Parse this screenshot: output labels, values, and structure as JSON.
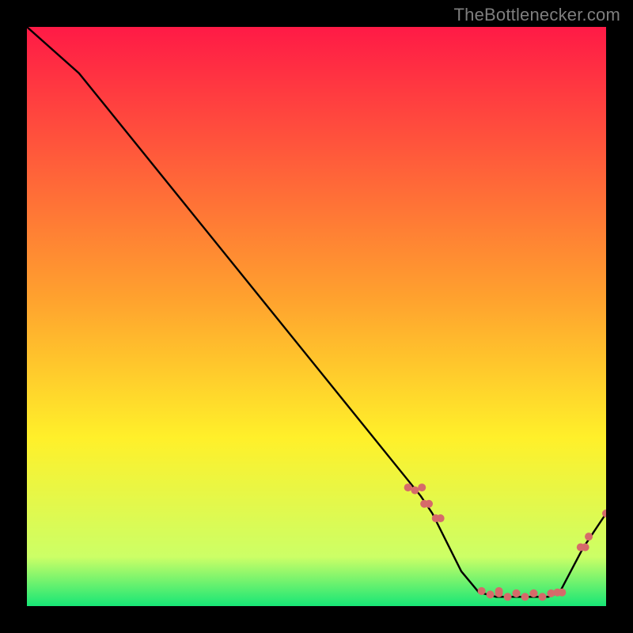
{
  "attribution": "TheBottlenecker.com",
  "colors": {
    "bg_black": "#000000",
    "grad_top": "#ff1a46",
    "grad_mid_orange": "#ffa22e",
    "grad_mid_yellow": "#fff02a",
    "grad_low_yellowgreen": "#ccff66",
    "grad_bottom_green": "#17e676",
    "line": "#000000",
    "marker": "#d66a6a",
    "attribution_gray": "#7e7e7e"
  },
  "chart_data": {
    "type": "line",
    "title": "",
    "xlabel": "",
    "ylabel": "",
    "xlim": [
      0,
      100
    ],
    "ylim": [
      0,
      100
    ],
    "line_points": [
      {
        "x": 0,
        "y": 100
      },
      {
        "x": 9,
        "y": 92
      },
      {
        "x": 68,
        "y": 19
      },
      {
        "x": 70,
        "y": 16
      },
      {
        "x": 75,
        "y": 6
      },
      {
        "x": 78,
        "y": 2.4
      },
      {
        "x": 81,
        "y": 1.6
      },
      {
        "x": 90,
        "y": 1.6
      },
      {
        "x": 92,
        "y": 2.4
      },
      {
        "x": 96,
        "y": 10
      },
      {
        "x": 100,
        "y": 16
      }
    ],
    "marker_clusters": [
      {
        "cx": 67,
        "cy": 20,
        "n": 3,
        "spread": 1.2
      },
      {
        "cx": 69,
        "cy": 17.5,
        "n": 2,
        "spread": 0.8
      },
      {
        "cx": 71,
        "cy": 15,
        "n": 2,
        "spread": 0.8
      },
      {
        "cx": 80,
        "cy": 2.0,
        "n": 3,
        "spread": 1.5
      },
      {
        "cx": 83,
        "cy": 1.6,
        "n": 3,
        "spread": 1.5
      },
      {
        "cx": 86,
        "cy": 1.6,
        "n": 3,
        "spread": 1.5
      },
      {
        "cx": 89,
        "cy": 1.6,
        "n": 3,
        "spread": 1.5
      },
      {
        "cx": 92,
        "cy": 2.2,
        "n": 2,
        "spread": 0.8
      },
      {
        "cx": 96,
        "cy": 10,
        "n": 2,
        "spread": 0.8
      },
      {
        "cx": 97,
        "cy": 12,
        "n": 1,
        "spread": 0.0
      },
      {
        "cx": 100,
        "cy": 16,
        "n": 1,
        "spread": 0.0
      }
    ],
    "gradient_stops": [
      {
        "pct": 0.0,
        "color_key": "grad_top"
      },
      {
        "pct": 0.47,
        "color_key": "grad_mid_orange"
      },
      {
        "pct": 0.71,
        "color_key": "grad_mid_yellow"
      },
      {
        "pct": 0.915,
        "color_key": "grad_low_yellowgreen"
      },
      {
        "pct": 1.0,
        "color_key": "grad_bottom_green"
      }
    ]
  }
}
